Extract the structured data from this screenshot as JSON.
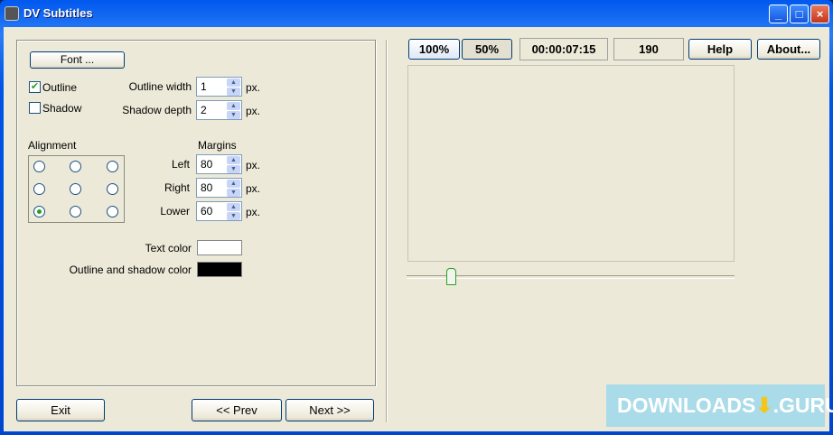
{
  "window": {
    "title": "DV Subtitles"
  },
  "left": {
    "font_button": "Font ...",
    "outline_label": "Outline",
    "outline_checked": true,
    "shadow_label": "Shadow",
    "shadow_checked": false,
    "outline_width_label": "Outline width",
    "outline_width": "1",
    "shadow_depth_label": "Shadow depth",
    "shadow_depth": "2",
    "px": "px.",
    "alignment_label": "Alignment",
    "alignment_selected": "bottom-left",
    "margins_label": "Margins",
    "left_label": "Left",
    "left_value": "80",
    "right_label": "Right",
    "right_value": "80",
    "lower_label": "Lower",
    "lower_value": "60",
    "text_color_label": "Text color",
    "text_color": "#ffffff",
    "outline_color_label": "Outline and shadow color",
    "outline_color": "#000000"
  },
  "nav": {
    "exit": "Exit",
    "prev": "<< Prev",
    "next": "Next >>"
  },
  "right": {
    "zoom100": "100%",
    "zoom50": "50%",
    "timecode": "00:00:07:15",
    "frame": "190",
    "help": "Help",
    "about": "About...",
    "slider_position_percent": 13.5
  },
  "watermark": {
    "text": "DOWNLOADS",
    "suffix": ".GURU"
  }
}
